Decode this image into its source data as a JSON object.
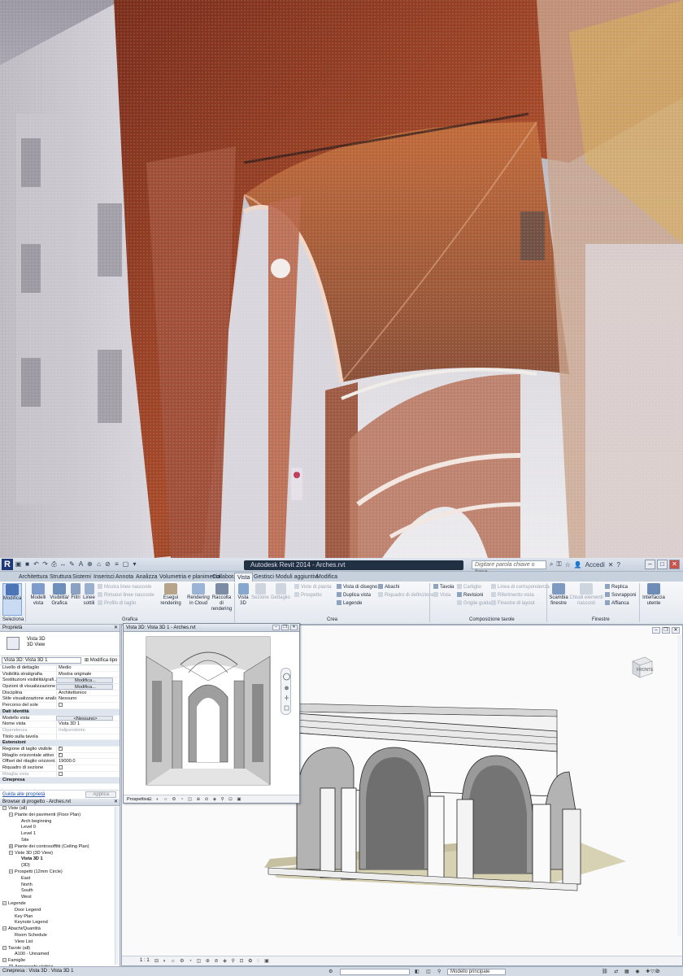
{
  "window": {
    "title": "Autodesk Revit 2014 -    Arches.rvt",
    "search_placeholder": "Digitare parola chiave o frase",
    "signin": "Accedi"
  },
  "tabs": [
    "Architettura",
    "Struttura",
    "Sistemi",
    "Inserisci",
    "Annota",
    "Analizza",
    "Volumetria e planimetria",
    "Collabora",
    "Vista",
    "Gestisci",
    "Moduli aggiuntivi",
    "Modifica"
  ],
  "ribbon": {
    "modifica": "Modifica",
    "seleziona": "Seleziona",
    "modelli_vista": "Modelli vista",
    "visibilita_grafica": "Visibilità/ Grafica",
    "filtri": "Filtri",
    "linee_sottili": "Linee sottili",
    "mostra_linee_nascoste": "Mostra linee nascoste",
    "rimuovi_linee_nascoste": "Rimuovi linee nascoste",
    "profilo_di_taglio": "Profilo di taglio",
    "grafica": "Grafica",
    "esegui_rendering": "Esegui rendering",
    "rendering_in_cloud": "Rendering in Cloud",
    "raccolta_di_rendering": "Raccolta di rendering",
    "vista_3d": "Vista 3D",
    "sezione": "Sezione",
    "dettaglio": "Dettaglio",
    "viste_di_pianta": "Viste di pianta",
    "prospetto": "Prospetto",
    "viste_di_disegno": "Vista di disegno",
    "duplica_vista": "Duplica vista",
    "legende": "Legende",
    "abachi": "Abachi",
    "riquadro_di_definizione": "Riquadro di definizione",
    "crea": "Crea",
    "tavola": "Tavola",
    "vista": "Vista",
    "cartiglio": "Cartiglio",
    "revisioni": "Revisioni",
    "griglie_guida": "Griglie guida",
    "linea_di_corrispondenza": "Linea di corrispondenza",
    "riferimento_vista": "Riferimento vista",
    "finestre_di_layout": "Finestre di layout",
    "composizione_tavole": "Composizione tavole",
    "scambia_finestre": "Scambia finestre",
    "chiudi_elementi_nascosti": "Chiudi elementi nascosti",
    "replica": "Replica",
    "sovrapponi": "Sovrapponi",
    "affianca": "Affianca",
    "finestre": "Finestre",
    "interfaccia_utente": "Interfaccia utente"
  },
  "properties": {
    "header": "Proprietà",
    "type_line1": "Vista 3D",
    "type_line2": "3D View",
    "selector": "Vista 3D: Vista 3D 1",
    "edit_type": "Modifica tipo",
    "rows": [
      {
        "k": "Livello di dettaglio",
        "v": "Medio"
      },
      {
        "k": "Visibilità stratigrafia",
        "v": "Mostra originale"
      },
      {
        "k": "Sostituzioni visibilità/grafi...",
        "v": "Modifica...",
        "btn": true
      },
      {
        "k": "Opzioni di visualizzazione ...",
        "v": "Modifica...",
        "btn": true
      },
      {
        "k": "Disciplina",
        "v": "Architettonico"
      },
      {
        "k": "Stile visualizzazione analis...",
        "v": "Nessuno"
      },
      {
        "k": "Percorso del sole",
        "v": "",
        "chk": false
      },
      {
        "k": "Dati identità",
        "v": "",
        "group": true
      },
      {
        "k": "Modello vista",
        "v": "<Nessuno>",
        "btn": true
      },
      {
        "k": "Nome vista",
        "v": "Vista 3D 1"
      },
      {
        "k": "Dipendenza",
        "v": "Indipendente",
        "dim": true
      },
      {
        "k": "Titolo sulla tavola",
        "v": ""
      },
      {
        "k": "Estensioni",
        "v": "",
        "group": true
      },
      {
        "k": "Regione di taglio visibile",
        "v": "",
        "chk": true
      },
      {
        "k": "Ritaglio orizzontale attivo",
        "v": "",
        "chk": true
      },
      {
        "k": "Offset del ritaglio orizzont...",
        "v": "19000.0"
      },
      {
        "k": "Riquadro di sezione",
        "v": "",
        "chk": false
      },
      {
        "k": "Ritaglia vista",
        "v": "",
        "chk": true,
        "dim": true
      },
      {
        "k": "Cinepresa",
        "v": "",
        "group": true
      }
    ],
    "help_link": "Guida alle proprietà",
    "apply": "Applica"
  },
  "browser": {
    "header": "Browser di progetto - Arches.rvt",
    "items": [
      {
        "t": "Viste (all)",
        "lvl": 0,
        "tg": "-"
      },
      {
        "t": "Piante dei pavimenti (Floor Plan)",
        "lvl": 1,
        "tg": "-"
      },
      {
        "t": "Arch beginning",
        "lvl": 2
      },
      {
        "t": "Level 0",
        "lvl": 2
      },
      {
        "t": "Level 1",
        "lvl": 2
      },
      {
        "t": "Site",
        "lvl": 2
      },
      {
        "t": "Piante dei controsoffitti (Ceiling Plan)",
        "lvl": 1,
        "tg": "+"
      },
      {
        "t": "Viste 3D (3D View)",
        "lvl": 1,
        "tg": "-"
      },
      {
        "t": "Vista 3D 1",
        "lvl": 2,
        "bold": true
      },
      {
        "t": "{3D}",
        "lvl": 2
      },
      {
        "t": "Prospetti (12mm Circle)",
        "lvl": 1,
        "tg": "-"
      },
      {
        "t": "East",
        "lvl": 2
      },
      {
        "t": "North",
        "lvl": 2
      },
      {
        "t": "South",
        "lvl": 2
      },
      {
        "t": "West",
        "lvl": 2
      },
      {
        "t": "Legende",
        "lvl": 0,
        "tg": "-"
      },
      {
        "t": "Door Legend",
        "lvl": 1
      },
      {
        "t": "Key Plan",
        "lvl": 1
      },
      {
        "t": "Keynote Legend",
        "lvl": 1
      },
      {
        "t": "Abachi/Quantità",
        "lvl": 0,
        "tg": "-"
      },
      {
        "t": "Room Schedule",
        "lvl": 1
      },
      {
        "t": "View List",
        "lvl": 1
      },
      {
        "t": "Tavole (all)",
        "lvl": 0,
        "tg": "-"
      },
      {
        "t": "A100 - Unnamed",
        "lvl": 1
      },
      {
        "t": "Famiglie",
        "lvl": 0,
        "tg": "-"
      },
      {
        "t": "Apparecchi elettrici",
        "lvl": 1,
        "tg": "+"
      }
    ]
  },
  "float_view": {
    "title": "Vista 3D: Vista 3D 1 - Arches.rvt",
    "footer_label": "Prospettiva"
  },
  "main_view": {
    "scale": "1 : 1",
    "viewcube_label": "FRONTE"
  },
  "status": {
    "text": "Cinepresa : Vista 3D : Vista 3D 1",
    "model": "Modello principale"
  }
}
